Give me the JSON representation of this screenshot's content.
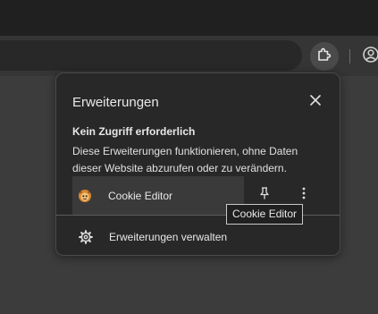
{
  "popup": {
    "title": "Erweiterungen",
    "close_icon": "close-icon",
    "section": {
      "title": "Kein Zugriff erforderlich",
      "description": "Diese Erweiterungen funktionieren, ohne Daten dieser Website abzurufen oder zu verändern."
    },
    "extensions": [
      {
        "name": "Cookie Editor",
        "icon": "cookie-icon",
        "pin_icon": "pin-icon",
        "menu_icon": "more-vert-icon"
      }
    ],
    "manage": {
      "label": "Erweiterungen verwalten",
      "icon": "gear-icon"
    }
  },
  "tooltip": {
    "text": "Cookie Editor"
  },
  "toolbar": {
    "extensions_icon": "puzzle-icon",
    "profile_icon": "profile-icon"
  },
  "colors": {
    "popup_bg": "#282828",
    "page_bg": "#3c3c3c",
    "toolbar_bg": "#353535",
    "tabstrip_bg": "#202020",
    "text": "#e8e8e8"
  }
}
